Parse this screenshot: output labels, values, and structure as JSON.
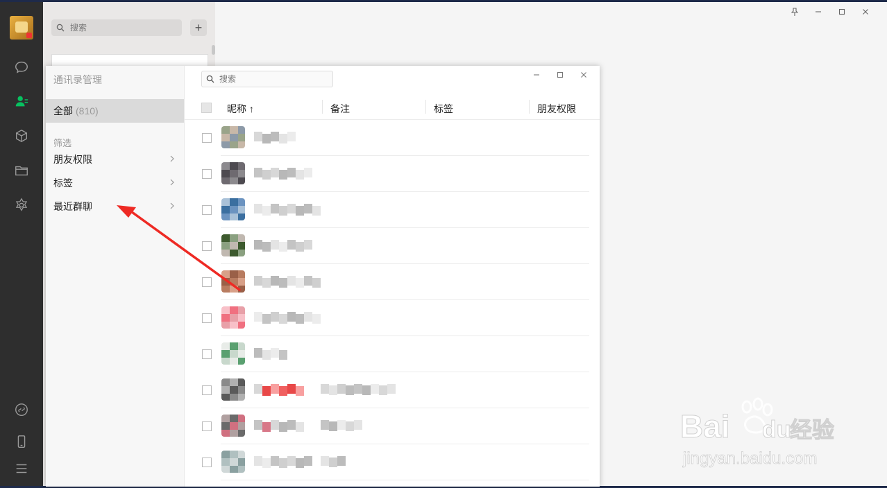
{
  "sidebar_search": {
    "placeholder": "搜索"
  },
  "window_controls": {
    "pin": "⊥",
    "minimize": "—",
    "maximize": "□",
    "close": "✕"
  },
  "dialog": {
    "title": "通讯录管理",
    "all": {
      "label": "全部",
      "count": "(810)"
    },
    "filter_header": "筛选",
    "filters": [
      {
        "label": "朋友权限"
      },
      {
        "label": "标签"
      },
      {
        "label": "最近群聊"
      }
    ],
    "search_placeholder": "搜索",
    "columns": {
      "nickname": "昵称 ↑",
      "remark": "备注",
      "tags": "标签",
      "permission": "朋友权限"
    }
  },
  "watermark": {
    "brand": "Baidu",
    "cn": "经验",
    "url": "jingyan.baidu.com"
  },
  "colors": {
    "accent_green": "#07c160",
    "annotation_red": "#ee2a24"
  },
  "icons": [
    "chat-icon",
    "contacts-icon",
    "box-icon",
    "folder-icon",
    "settings-wheel-icon",
    "mini-program-icon",
    "phone-icon",
    "menu-icon"
  ]
}
